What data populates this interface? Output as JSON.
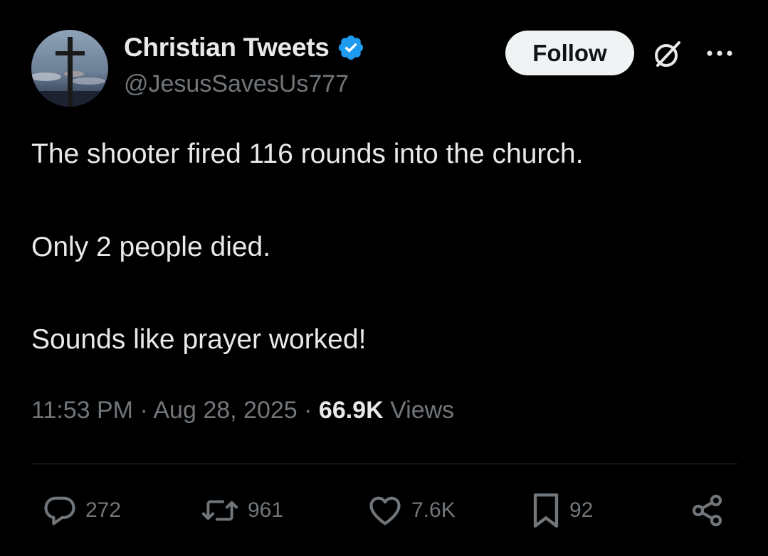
{
  "author": {
    "display_name": "Christian Tweets",
    "handle": "@JesusSavesUs777",
    "verified": true,
    "verified_color": "#1d9bf0",
    "avatar_icon": "cross-avatar"
  },
  "header": {
    "follow_label": "Follow",
    "grok_icon": "grok-icon",
    "more_icon": "more-icon"
  },
  "body": {
    "lines": [
      "The shooter fired 116 rounds into the church.",
      "Only 2 people died.",
      "Sounds like prayer worked!"
    ]
  },
  "meta": {
    "time": "11:53 PM",
    "separator": "·",
    "date": "Aug 28, 2025",
    "views_count": "66.9K",
    "views_label": "Views"
  },
  "actions": {
    "replies": "272",
    "reposts": "961",
    "likes": "7.6K",
    "bookmarks": "92",
    "share_icon": "share-icon"
  },
  "colors": {
    "background": "#000000",
    "text": "#e7e9ea",
    "secondary": "#71767b",
    "divider": "#2f3336",
    "button_bg": "#eff3f4"
  }
}
